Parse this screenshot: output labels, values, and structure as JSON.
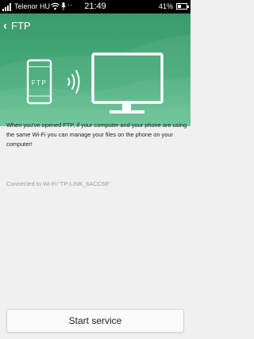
{
  "status_bar": {
    "carrier": "Telenor HU",
    "extra": "··",
    "time": "21:49",
    "battery_percent": "41%",
    "battery_level": 0.41
  },
  "header": {
    "back_icon": "chevron-left-icon",
    "title": "FTP"
  },
  "hero": {
    "phone_label": "FTP",
    "icons": [
      "phone-icon",
      "wireless-signal-icon",
      "monitor-icon"
    ]
  },
  "main": {
    "description": "When you've opened FTP, if your computer and your phone are using the same Wi-Fi you can manage your files on the phone on your computer!",
    "connection_status": "Connected to Wi-Fi:\"TP-LINK_6ACC68\""
  },
  "footer": {
    "start_label": "Start service"
  },
  "colors": {
    "header_green": "#3a9a6b",
    "hero_green_light": "#5fbf8e",
    "background": "#f0f0f0"
  }
}
